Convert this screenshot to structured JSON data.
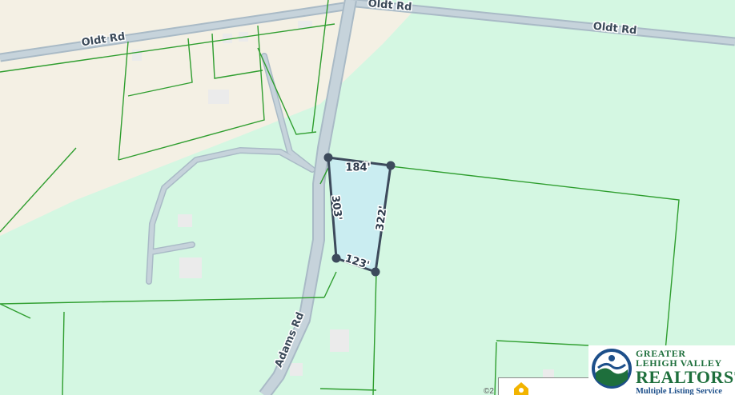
{
  "map": {
    "roads": [
      {
        "id": "oldt-rd-left",
        "name": "Oldt Rd"
      },
      {
        "id": "oldt-rd-top",
        "name": "Oldt Rd"
      },
      {
        "id": "oldt-rd-right",
        "name": "Oldt Rd"
      },
      {
        "id": "adams-rd",
        "name": "Adams Rd"
      }
    ],
    "parcel": {
      "dimensions": {
        "top": "184'",
        "left": "303'",
        "right": "322'",
        "bottom": "123'"
      },
      "fill_color": "#c9ecf1",
      "outline_color": "#3d4a5c"
    },
    "colors": {
      "land_green": "#d4f7e2",
      "land_beige": "#f4f0e4",
      "parcel_lines": "#2f9e2f",
      "road_fill": "#c6d3db",
      "road_edge": "#a9bac6"
    }
  },
  "logo": {
    "line1": "GREATER",
    "line2": "LEHIGH VALLEY",
    "line3": "REALTORS",
    "registered_mark": "®",
    "line4": "Multiple Listing Service",
    "colors": {
      "green": "#1e6f3c",
      "blue": "#1d4f8a"
    }
  },
  "attribution": "©2",
  "mini_card": {
    "icon": "house-marker-icon",
    "icon_color": "#f2b400"
  }
}
